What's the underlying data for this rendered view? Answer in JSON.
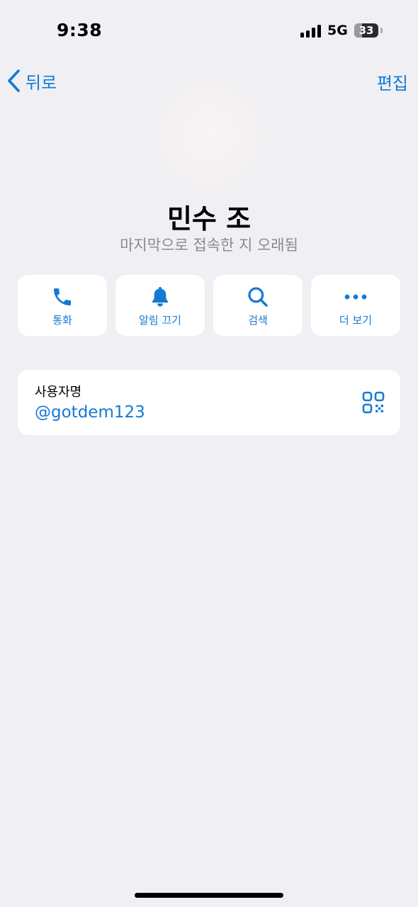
{
  "status_bar": {
    "time": "9:38",
    "network": "5G",
    "battery": "33",
    "battery_level": 0.33
  },
  "nav": {
    "back_label": "뒤로",
    "edit_label": "편집"
  },
  "profile": {
    "name": "민수 조",
    "last_seen": "마지막으로 접속한 지 오래됨"
  },
  "actions": [
    {
      "label": "통화",
      "icon": "phone-icon"
    },
    {
      "label": "알림 끄기",
      "icon": "bell-icon"
    },
    {
      "label": "검색",
      "icon": "search-icon"
    },
    {
      "label": "더 보기",
      "icon": "more-icon"
    }
  ],
  "username_card": {
    "label": "사용자명",
    "value": "@gotdem123",
    "icon": "qr-code-icon"
  },
  "colors": {
    "accent": "#1479d4",
    "background": "#efeff4",
    "card": "#ffffff",
    "secondary_text": "#8a8a8e"
  }
}
